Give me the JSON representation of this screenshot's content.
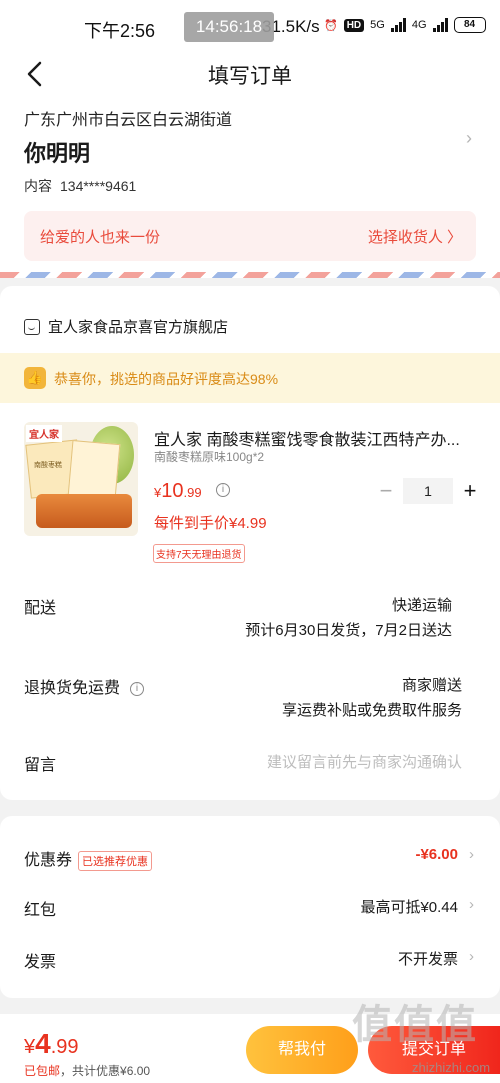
{
  "status": {
    "time": "下午2:56",
    "overlay_time": "14:56:18",
    "speed": "31.5K/s",
    "hd": "HD",
    "net5g": "5G",
    "net4g": "4G",
    "battery": "84"
  },
  "nav": {
    "title": "填写订单"
  },
  "address": {
    "line": "广东广州市白云区白云湖街道",
    "name": "你明明",
    "phone_label": "内容",
    "phone": "134****9461",
    "gift_text": "给爱的人也来一份",
    "gift_action": "选择收货人 〉"
  },
  "store": {
    "name": "宜人家食品京喜官方旗舰店",
    "praise": "恭喜你，挑选的商品好评度高达98%"
  },
  "product": {
    "image_logo": "宜人家",
    "image_label": "南酸枣糕",
    "title": "宜人家 南酸枣糕蜜饯零食散装江西特产办...",
    "spec": "南酸枣糕原味100g*2",
    "price_currency": "¥",
    "price_int": "10",
    "price_dec": ".99",
    "per_price": "每件到手价¥4.99",
    "return_tag": "支持7天无理由退货",
    "qty": "1",
    "minus": "−",
    "plus": "+"
  },
  "rows": {
    "delivery_label": "配送",
    "delivery_method": "快递运输",
    "delivery_eta": "预计6月30日发货，7月2日送达",
    "return_label": "退换货免运费",
    "return_value": "商家赠送",
    "return_detail": "享运费补贴或免费取件服务",
    "message_label": "留言",
    "message_placeholder": "建议留言前先与商家沟通确认"
  },
  "discounts": {
    "coupon_label": "优惠券",
    "coupon_tag": "已选推荐优惠",
    "coupon_value": "-¥6.00",
    "redpack_label": "红包",
    "redpack_value": "最高可抵¥0.44",
    "invoice_label": "发票",
    "invoice_value": "不开发票"
  },
  "bottom": {
    "total_currency": "¥",
    "total_int": "4",
    "total_dec": ".99",
    "shipping": "已包邮",
    "saved_prefix": "，共计优惠",
    "saved_value": "¥6.00",
    "help_button": "帮我付",
    "submit_button": "提交订单",
    "watermark": "值值值",
    "watermark_url": "zhizhizhi.com"
  }
}
